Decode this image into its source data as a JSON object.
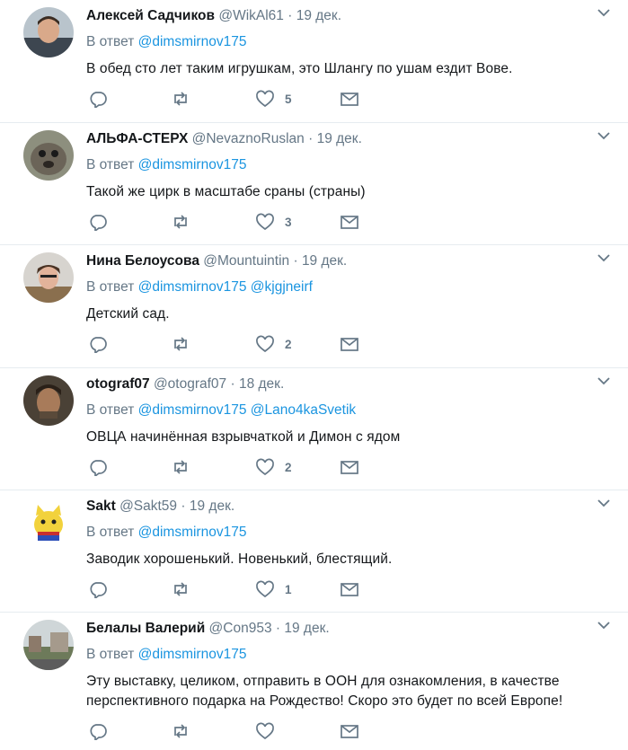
{
  "ui": {
    "reply_prefix": "В ответ",
    "dot": "·"
  },
  "tweets": [
    {
      "name": "Алексей Садчиков",
      "handle": "@WikAl61",
      "date": "19 дек.",
      "mentions": [
        "@dimsmirnov175"
      ],
      "text": "В обед сто лет таким игрушкам, это Шлангу по ушам ездит Вове.",
      "likes": "5"
    },
    {
      "name": "АЛЬФА-СТЕРХ",
      "handle": "@NevaznoRuslan",
      "date": "19 дек.",
      "mentions": [
        "@dimsmirnov175"
      ],
      "text": "Такой же цирк в масштабе сраны (страны)",
      "likes": "3"
    },
    {
      "name": "Нина Белоусова",
      "handle": "@Mountuintin",
      "date": "19 дек.",
      "mentions": [
        "@dimsmirnov175",
        "@kjgjneirf"
      ],
      "text": "Детский сад.",
      "likes": "2"
    },
    {
      "name": "otograf07",
      "handle": "@otograf07",
      "date": "18 дек.",
      "mentions": [
        "@dimsmirnov175",
        "@Lano4kaSvetik"
      ],
      "text": "ОВЦА начинённая взрывчаткой и Димон с ядом",
      "likes": "2"
    },
    {
      "name": "Sakt",
      "handle": "@Sakt59",
      "date": "19 дек.",
      "mentions": [
        "@dimsmirnov175"
      ],
      "text": "Заводик хорошенький. Новенький, блестящий.",
      "likes": "1"
    },
    {
      "name": "Белалы Валерий",
      "handle": "@Con953",
      "date": "19 дек.",
      "mentions": [
        "@dimsmirnov175"
      ],
      "text": "Эту выставку, целиком, отправить в ООН для ознакомления, в качестве перспективного подарка на Рождество! Скоро это будет по всей Европе!",
      "likes": ""
    }
  ],
  "icons": {
    "reply": "reply-icon",
    "retweet": "retweet-icon",
    "like": "heart-icon",
    "dm": "envelope-icon",
    "menu": "chevron-down-icon"
  },
  "colors": {
    "text": "#14171a",
    "muted": "#657786",
    "link": "#1b95e0",
    "border": "#e6ecf0"
  }
}
